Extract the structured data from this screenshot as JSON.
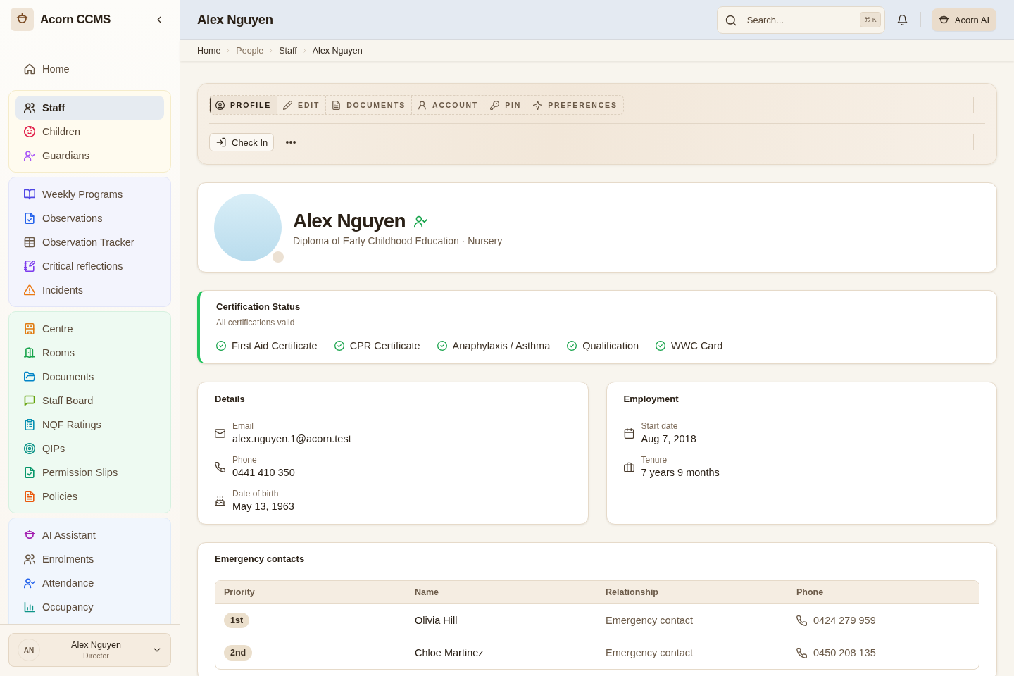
{
  "sidebar": {
    "brand": "Acorn CCMS",
    "groups": [
      {
        "items": [
          {
            "label": "Home",
            "selected": false,
            "color": "#6b5a48"
          }
        ]
      },
      {
        "items": [
          {
            "label": "Staff",
            "selected": true,
            "color": "#3a2e22"
          },
          {
            "label": "Children",
            "selected": false,
            "color": "#e11d48"
          },
          {
            "label": "Guardians",
            "selected": false,
            "color": "#a855f7"
          }
        ]
      },
      {
        "items": [
          {
            "label": "Weekly Programs",
            "selected": false,
            "color": "#4f46e5"
          },
          {
            "label": "Observations",
            "selected": false,
            "color": "#2563eb"
          },
          {
            "label": "Observation Tracker",
            "selected": false,
            "color": "#6b5a48"
          },
          {
            "label": "Critical reflections",
            "selected": false,
            "color": "#7c3aed"
          },
          {
            "label": "Incidents",
            "selected": false,
            "color": "#ea7a14"
          }
        ]
      },
      {
        "items": [
          {
            "label": "Centre",
            "selected": false,
            "color": "#e07b12"
          },
          {
            "label": "Rooms",
            "selected": false,
            "color": "#16a34a"
          },
          {
            "label": "Documents",
            "selected": false,
            "color": "#0284c7"
          },
          {
            "label": "Staff Board",
            "selected": false,
            "color": "#65a30d"
          },
          {
            "label": "NQF Ratings",
            "selected": false,
            "color": "#0891b2"
          },
          {
            "label": "QIPs",
            "selected": false,
            "color": "#0d9488"
          },
          {
            "label": "Permission Slips",
            "selected": false,
            "color": "#059669"
          },
          {
            "label": "Policies",
            "selected": false,
            "color": "#ea580c"
          }
        ]
      },
      {
        "items": [
          {
            "label": "AI Assistant",
            "selected": false,
            "color": "#a21caf"
          },
          {
            "label": "Enrolments",
            "selected": false,
            "color": "#6b5a48"
          },
          {
            "label": "Attendance",
            "selected": false,
            "color": "#2563eb"
          },
          {
            "label": "Occupancy",
            "selected": false,
            "color": "#0d9488"
          }
        ]
      }
    ],
    "user": {
      "initials": "AN",
      "name": "Alex Nguyen",
      "role": "Director"
    }
  },
  "header": {
    "title": "Alex Nguyen",
    "search": {
      "placeholder": "Search...",
      "shortcut": "⌘ K"
    },
    "ai_button": "Acorn AI"
  },
  "breadcrumb": [
    {
      "label": "Home",
      "kind": "link"
    },
    {
      "label": "People",
      "kind": "text"
    },
    {
      "label": "Staff",
      "kind": "link"
    },
    {
      "label": "Alex Nguyen",
      "kind": "current"
    }
  ],
  "tabs": [
    {
      "label": "PROFILE",
      "selected": true
    },
    {
      "label": "EDIT",
      "selected": false
    },
    {
      "label": "DOCUMENTS",
      "selected": false
    },
    {
      "label": "ACCOUNT",
      "selected": false
    },
    {
      "label": "PIN",
      "selected": false
    },
    {
      "label": "PREFERENCES",
      "selected": false
    }
  ],
  "actions": {
    "check_in": "Check In"
  },
  "profile": {
    "name": "Alex Nguyen",
    "subtitle": "Diploma of Early Childhood Education · Nursery"
  },
  "certification": {
    "title": "Certification Status",
    "summary": "All certifications valid",
    "items": [
      {
        "label": "First Aid Certificate",
        "valid": true
      },
      {
        "label": "CPR Certificate",
        "valid": true
      },
      {
        "label": "Anaphylaxis / Asthma",
        "valid": true
      },
      {
        "label": "Qualification",
        "valid": true
      },
      {
        "label": "WWC Card",
        "valid": true
      }
    ]
  },
  "details": {
    "title": "Details",
    "fields": [
      {
        "label": "Email",
        "value": "alex.nguyen.1@acorn.test"
      },
      {
        "label": "Phone",
        "value": "0441 410 350"
      },
      {
        "label": "Date of birth",
        "value": "May 13, 1963"
      }
    ]
  },
  "employment": {
    "title": "Employment",
    "fields": [
      {
        "label": "Start date",
        "value": "Aug 7, 2018"
      },
      {
        "label": "Tenure",
        "value": "7 years 9 months"
      }
    ]
  },
  "emergency_contacts": {
    "title": "Emergency contacts",
    "columns": [
      "Priority",
      "Name",
      "Relationship",
      "Phone"
    ],
    "rows": [
      {
        "priority": "1st",
        "name": "Olivia Hill",
        "relationship": "Emergency contact",
        "phone": "0424 279 959"
      },
      {
        "priority": "2nd",
        "name": "Chloe Martinez",
        "relationship": "Emergency contact",
        "phone": "0450 208 135"
      }
    ]
  }
}
